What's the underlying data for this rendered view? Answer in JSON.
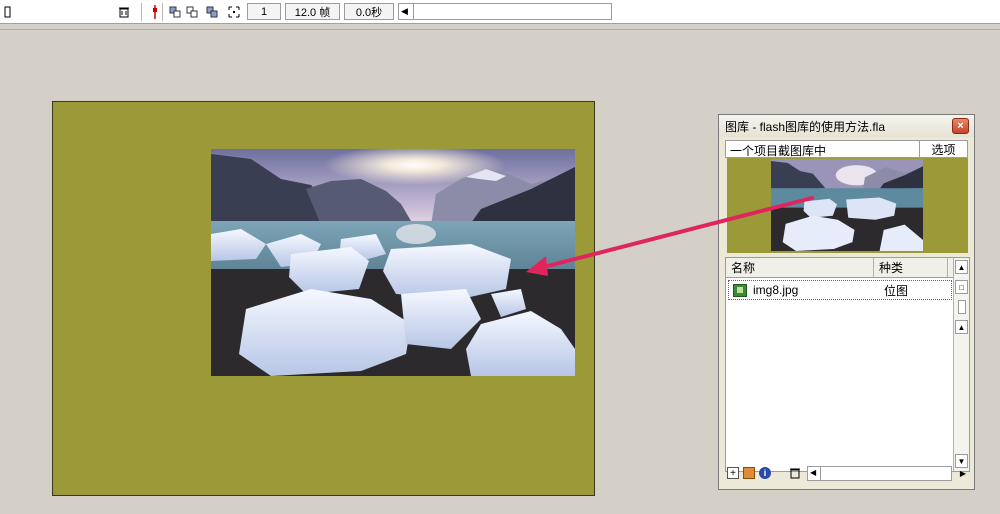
{
  "timeline": {
    "frame_number": "1",
    "frame_rate": "12.0 帧",
    "elapsed_time": "0.0秒"
  },
  "library": {
    "title": "图库 - flash图库的使用方法.fla",
    "item_count": "一个项目截图库中",
    "options_label": "选项",
    "columns": {
      "name": "名称",
      "kind": "种类"
    },
    "items": [
      {
        "name": "img8.jpg",
        "kind": "位图"
      }
    ]
  },
  "colors": {
    "stage_background": "#9c9a38",
    "annotation_arrow": "#e0245e"
  },
  "icons": [
    "trash-icon",
    "onion-skin-icon",
    "edit-multiple-frames-icon",
    "modify-markers-icon",
    "close-icon",
    "bitmap-icon",
    "new-symbol-icon",
    "new-folder-icon",
    "properties-icon",
    "delete-icon"
  ]
}
